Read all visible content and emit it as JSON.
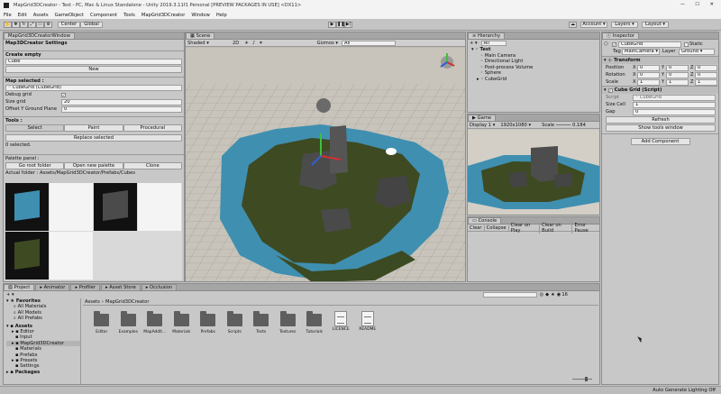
{
  "window": {
    "title": "MapGrid3DCreator - Test - PC, Mac & Linux Standalone - Unity 2019.3.11f1 Personal [PREVIEW PACKAGES IN USE] <DX11>"
  },
  "menu": [
    "File",
    "Edit",
    "Assets",
    "GameObject",
    "Component",
    "Tools",
    "MapGrid3DCreator",
    "Window",
    "Help"
  ],
  "toolbar": {
    "center": "Center",
    "global": "Global",
    "account": "Account",
    "layers": "Layers",
    "layout": "Layout"
  },
  "creator": {
    "tab": "MapGrid3DCreatorWindow",
    "title": "Map3DCreator Settings",
    "create_empty": "Create empty",
    "type_value": "Cube",
    "new_btn": "New",
    "map_selected": "Map selected :",
    "map_value": "CubeGrid (CubeGrid)",
    "debug_grid": "Debug grid",
    "size_grid_label": "Size grid",
    "size_grid_value": "20",
    "offset_label": "Offset Y Ground Plane",
    "offset_value": "0",
    "tools_label": "Tools :",
    "tools": [
      "Select",
      "Paint",
      "Procedural"
    ],
    "replace_btn": "Replace selected",
    "selected_count": "0 selected.",
    "palette_panel": "Palette panel :",
    "goto_root": "Go root folder",
    "open_new_palette": "Open new palette",
    "clone": "Clone",
    "actual_folder": "Actual folder : Assets/MapGrid3DCreator/Prefabs/Cubes"
  },
  "scene": {
    "tab": "Scene",
    "shading": "Shaded",
    "mode_2d": "2D",
    "gizmos": "Gizmos",
    "search": "All"
  },
  "hierarchy": {
    "tab": "Hierarchy",
    "search": "All",
    "root": "Test",
    "items": [
      "Main Camera",
      "Directional Light",
      "Post-process Volume",
      "Sphere",
      "CubeGrid"
    ]
  },
  "game": {
    "tab": "Game",
    "display": "Display 1",
    "resolution": "1920x1080",
    "scale_label": "Scale",
    "scale_value": "0.184"
  },
  "console": {
    "tab": "Console",
    "buttons": [
      "Clear",
      "Collapse",
      "Clear on Play",
      "Clear on Build",
      "Error Pause"
    ]
  },
  "inspector": {
    "tab": "Inspector",
    "object_name": "CubeGrid",
    "static": "Static",
    "tag_label": "Tag",
    "tag_value": "MainCamera",
    "layer_label": "Layer",
    "layer_value": "Ground",
    "transform": "Transform",
    "rows": [
      {
        "label": "Position",
        "x": "0",
        "y": "0",
        "z": "0"
      },
      {
        "label": "Rotation",
        "x": "0",
        "y": "0",
        "z": "0"
      },
      {
        "label": "Scale",
        "x": "1",
        "y": "1",
        "z": "1"
      }
    ],
    "axes": [
      "X",
      "Y",
      "Z"
    ],
    "script_header": "Cube Grid (Script)",
    "script_label": "Script",
    "script_value": "CubeGrid",
    "size_cell_label": "Size Cell",
    "size_cell_value": "1",
    "gap_label": "Gap",
    "gap_value": "0",
    "refresh": "Refresh",
    "show_tools": "Show tools window",
    "add_component": "Add Component"
  },
  "project": {
    "tabs": [
      "Project",
      "Animator",
      "Profiler",
      "Asset Store",
      "Occlusion"
    ],
    "breadcrumb_root": "Assets",
    "breadcrumb_folder": "MapGrid3DCreator",
    "count": "16",
    "favorites_label": "Favorites",
    "favorites": [
      "All Materials",
      "All Models",
      "All Prefabs"
    ],
    "assets_label": "Assets",
    "assets_tree": [
      "Editor",
      "Input",
      "MapGrid3DCreator",
      "Materials",
      "Prefabs",
      "Presets",
      "Settings"
    ],
    "packages_label": "Packages",
    "files": [
      {
        "name": "Editor",
        "kind": "folder"
      },
      {
        "name": "Examples",
        "kind": "folder"
      },
      {
        "name": "MapAddit...",
        "kind": "folder"
      },
      {
        "name": "Materials",
        "kind": "folder"
      },
      {
        "name": "Prefabs",
        "kind": "folder"
      },
      {
        "name": "Scripts",
        "kind": "folder"
      },
      {
        "name": "Tests",
        "kind": "folder"
      },
      {
        "name": "Textures",
        "kind": "folder"
      },
      {
        "name": "Tutorials",
        "kind": "folder"
      },
      {
        "name": "LICENCE",
        "kind": "doc"
      },
      {
        "name": "README",
        "kind": "doc"
      }
    ]
  },
  "status": {
    "text": "Auto Generate Lighting Off"
  },
  "colors": {
    "water": "#3f8fb0",
    "grass": "#3e4a22",
    "rock": "#4b4b4b",
    "select": "#3a72b0"
  }
}
